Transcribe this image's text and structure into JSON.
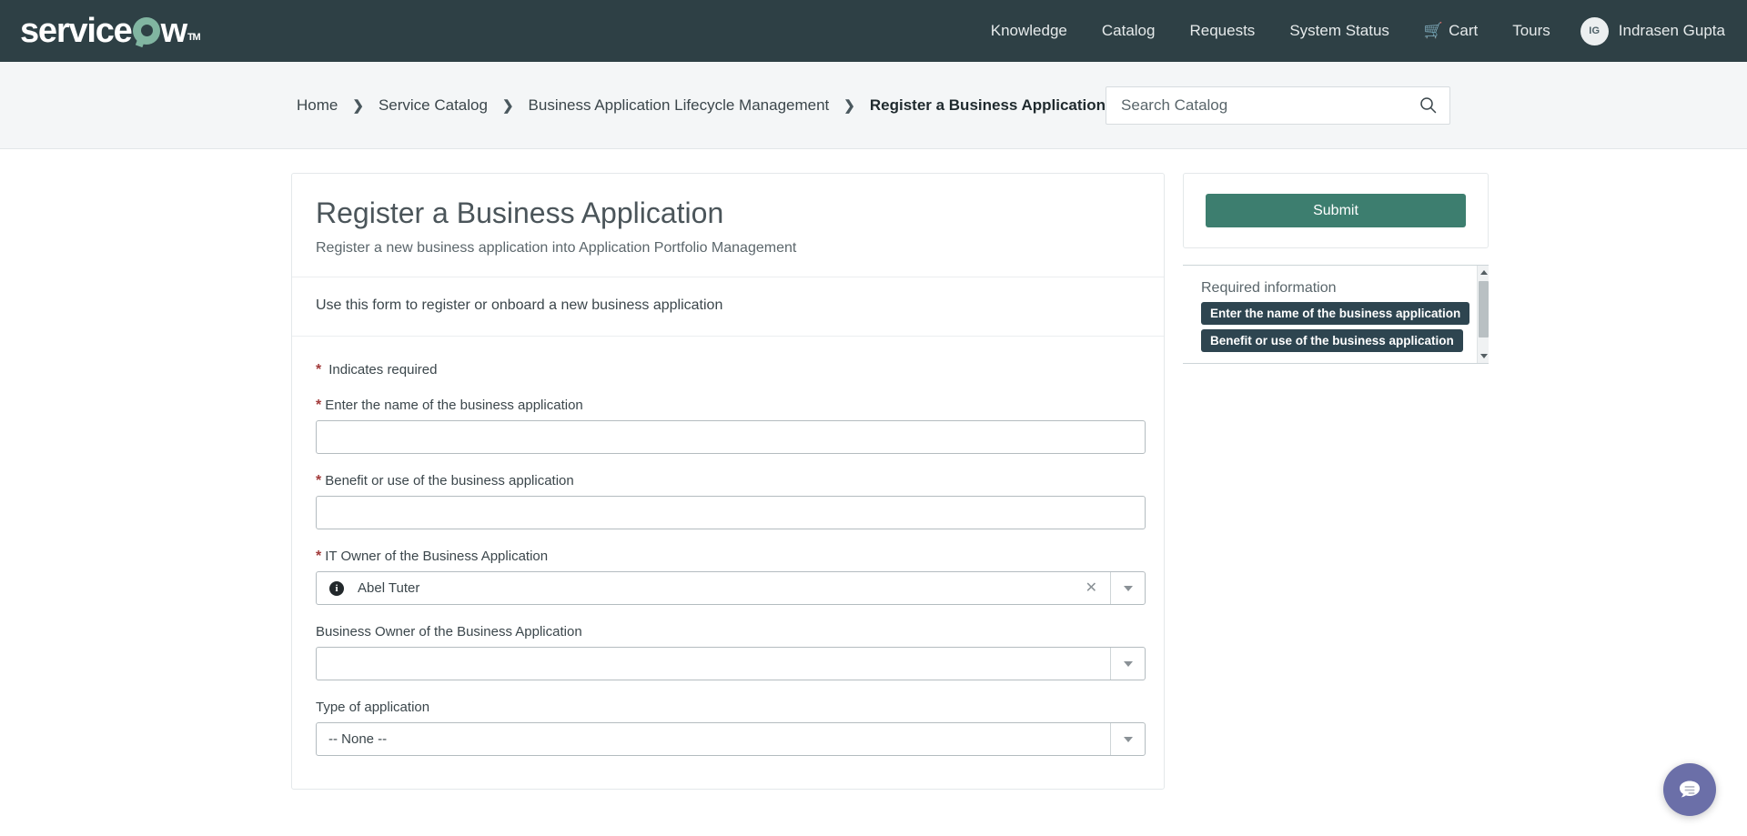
{
  "header": {
    "logo_text_pre": "service",
    "logo_text_post": "w",
    "logo_tm": "TM",
    "nav": [
      {
        "label": "Knowledge",
        "name": "nav-knowledge"
      },
      {
        "label": "Catalog",
        "name": "nav-catalog"
      },
      {
        "label": "Requests",
        "name": "nav-requests"
      },
      {
        "label": "System Status",
        "name": "nav-system-status"
      }
    ],
    "cart_label": "Cart",
    "tours_label": "Tours",
    "user": {
      "initials": "IG",
      "name": "Indrasen Gupta"
    }
  },
  "breadcrumb": {
    "items": [
      {
        "label": "Home"
      },
      {
        "label": "Service Catalog"
      },
      {
        "label": "Business Application Lifecycle Management"
      },
      {
        "label": "Register a Business Application"
      }
    ],
    "separator": "❯"
  },
  "search": {
    "placeholder": "Search Catalog",
    "value": ""
  },
  "form": {
    "title": "Register a Business Application",
    "subtitle": "Register a new business application into Application Portfolio Management",
    "description": "Use this form to register or onboard a new business application",
    "required_note": "Indicates required",
    "required_marker": "*",
    "fields": [
      {
        "label": "Enter the name of the business application",
        "required": true,
        "type": "text",
        "value": "",
        "name": "app-name"
      },
      {
        "label": "Benefit or use of the business application",
        "required": true,
        "type": "text",
        "value": "",
        "name": "app-benefit"
      },
      {
        "label": "IT Owner of the Business Application",
        "required": true,
        "type": "reference",
        "value": "Abel Tuter",
        "name": "it-owner"
      },
      {
        "label": "Business Owner of the Business Application",
        "required": false,
        "type": "reference",
        "value": "",
        "name": "business-owner"
      },
      {
        "label": "Type of application",
        "required": false,
        "type": "select",
        "value": "-- None --",
        "name": "application-type"
      }
    ]
  },
  "rail": {
    "submit_label": "Submit",
    "required_info_title": "Required information",
    "required_items": [
      "Enter the name of the business application",
      "Benefit or use of the business application"
    ]
  },
  "colors": {
    "header_bg": "#2e4045",
    "logo_accent": "#81b5a1",
    "submit_bg": "#3d7e6f",
    "required_star": "#a23b3b",
    "badge_bg": "#2e4550",
    "chat_fab": "#6b6fa8"
  }
}
